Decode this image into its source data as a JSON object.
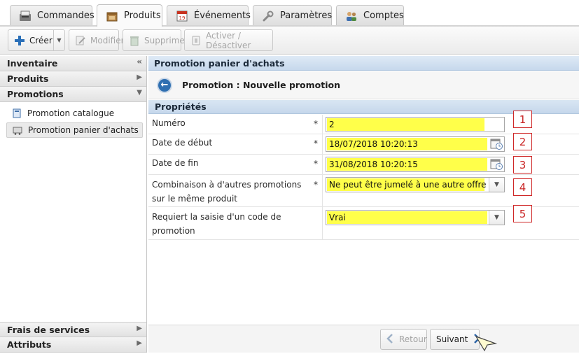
{
  "tabs": [
    {
      "label": "Commandes",
      "icon": "orders-icon",
      "active": false
    },
    {
      "label": "Produits",
      "icon": "products-box-icon",
      "active": true
    },
    {
      "label": "Événements",
      "icon": "calendar-icon",
      "active": false
    },
    {
      "label": "Paramètres",
      "icon": "wrench-icon",
      "active": false
    },
    {
      "label": "Comptes",
      "icon": "users-icon",
      "active": false
    }
  ],
  "toolbar": {
    "create_label": "Créer",
    "edit_label": "Modifier",
    "delete_label": "Supprimer",
    "toggle_label": "Activer / Désactiver"
  },
  "sidebar": {
    "inventory": "Inventaire",
    "products": "Produits",
    "promotions": "Promotions",
    "promo_items": [
      "Promotion catalogue",
      "Promotion panier d'achats"
    ],
    "service_fees": "Frais de services",
    "attributes": "Attributs"
  },
  "main": {
    "panel_title": "Promotion panier d'achats",
    "subtitle": "Promotion : Nouvelle promotion",
    "section_title": "Propriétés",
    "fields": [
      {
        "label": "Numéro",
        "required": "*",
        "value": "2",
        "marker": "1"
      },
      {
        "label": "Date de début",
        "required": "*",
        "value": "18/07/2018 10:20:13",
        "marker": "2"
      },
      {
        "label": "Date de fin",
        "required": "*",
        "value": "31/08/2018 10:20:15",
        "marker": "3"
      },
      {
        "label": "Combinaison à d'autres promotions sur le même produit",
        "required": "*",
        "value": "Ne peut être jumelé à une autre offre",
        "marker": "4"
      },
      {
        "label": "Requiert la saisie d'un code de promotion",
        "required": "",
        "value": "Vrai",
        "marker": "5"
      }
    ],
    "back_button": "Retour",
    "next_button": "Suivant"
  },
  "colors": {
    "highlight": "#ffff4a",
    "marker_red": "#cf2626",
    "panel_blue": "#c6d8ec",
    "back_circle": "#2f6fb1"
  }
}
